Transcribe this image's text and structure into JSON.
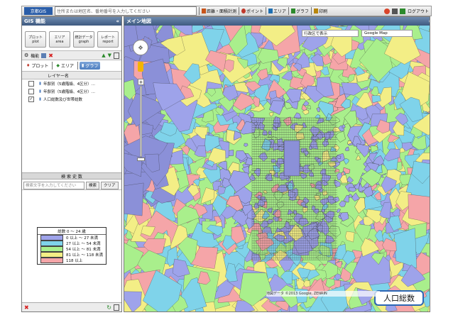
{
  "toolbar": {
    "logo_text": "京都GIS",
    "address_placeholder": "住所または地区名、番地番号を入力してください",
    "items": [
      {
        "label": "距離・面積計測",
        "icon": "ruler-icon",
        "color": "#c7541a"
      },
      {
        "label": "ポイント",
        "icon": "point-icon",
        "color": "#c0392b"
      },
      {
        "label": "エリア",
        "icon": "area-icon",
        "color": "#1f6fb2"
      },
      {
        "label": "グラフ",
        "icon": "graph-icon",
        "color": "#2c8a2c"
      },
      {
        "label": "印刷",
        "icon": "print-icon",
        "color": "#b8860b"
      }
    ],
    "right_label": "ログアウト"
  },
  "left_panel": {
    "title": "GIS 機能",
    "buttons": [
      {
        "line1": "プロット",
        "line2": "plot"
      },
      {
        "line1": "エリア",
        "line2": "area"
      },
      {
        "line1": "統計データ",
        "line2": "graph"
      },
      {
        "line1": "レポート",
        "line2": "report"
      }
    ],
    "settings_label": "機能",
    "tabs": [
      {
        "label": "プロット",
        "active": false
      },
      {
        "label": "エリア",
        "active": false
      },
      {
        "label": "グラフ",
        "active": true
      }
    ],
    "layers_header": "レイヤー名",
    "layers": [
      {
        "label": "年齢別（5歳階級、4区分）…",
        "checked": false
      },
      {
        "label": "年齢別（5歳階級、4区分）…",
        "checked": false
      },
      {
        "label": "人口総数及び世帯総数",
        "checked": true
      }
    ],
    "search_header": "検 索 史 数",
    "search_placeholder": "検索文字を入力してください",
    "search_button": "検索",
    "clear_button": "クリア",
    "legend": {
      "title": "総数 0 ～ 24 歳",
      "rows": [
        {
          "label": "0 以上 ～ 27 未満",
          "color": "#9ea3ea"
        },
        {
          "label": "27 以上 ～ 54 未満",
          "color": "#7fd3ea"
        },
        {
          "label": "54 以上 ～ 81 未満",
          "color": "#a9ef8c"
        },
        {
          "label": "81 以上 ～ 118 未満",
          "color": "#f3ee86"
        },
        {
          "label": "118 以上",
          "color": "#f5a5a8"
        }
      ]
    }
  },
  "map": {
    "title": "メイン地図",
    "basemap_label": "Google Map",
    "overlay_label": "行政区で表示",
    "copyright": "地図データ ©2013 Google, ZENRIN",
    "badge": "人口総数",
    "colors": [
      "#9ea3ea",
      "#7fd3ea",
      "#a9ef8c",
      "#f3ee86",
      "#f5a5a8",
      "#8b90d8"
    ]
  }
}
